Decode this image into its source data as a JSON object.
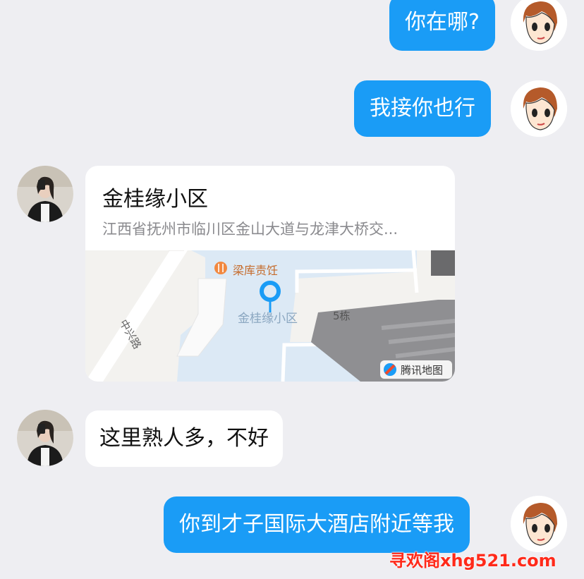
{
  "messages": {
    "m1": "你在哪?",
    "m2": "我接你也行",
    "m3": "这里熟人多，不好",
    "m4": "你到才子国际大酒店附近等我"
  },
  "location": {
    "name": "金桂缘小区",
    "address": "江西省抚州市临川区金山大道与龙津大桥交...",
    "map": {
      "poi_restaurant": "梁库责饪",
      "pin_label": "金桂缘小区",
      "building_label": "5栋",
      "road_label": "中兴路",
      "provider": "腾讯地图"
    }
  },
  "watermark": "寻欢阁xhg521.com",
  "colors": {
    "my_bubble": "#1a9cf6",
    "background": "#eeeef2",
    "pin": "#1a9cf6"
  },
  "icons": {
    "restaurant": "fork-knife-icon",
    "pin": "map-pin-icon",
    "provider": "tencent-map-logo-icon"
  }
}
